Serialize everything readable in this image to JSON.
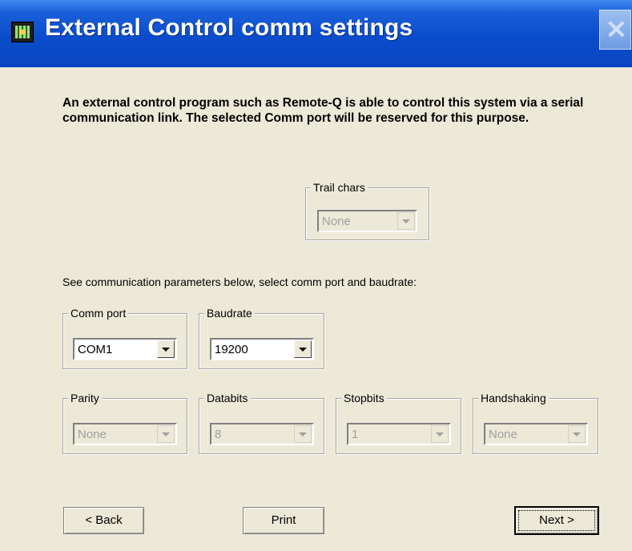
{
  "window": {
    "title": "External Control comm settings",
    "close_label": "X"
  },
  "intro": "An external control program such as Remote-Q is able to control this system via a serial communication link. The selected Comm port will be reserved for this purpose.",
  "trail_chars": {
    "label": "Trail chars",
    "value": "None",
    "enabled": false
  },
  "instruction": "See communication parameters below, select comm port and baudrate:",
  "comm_port": {
    "label": "Comm port",
    "value": "COM1",
    "enabled": true
  },
  "baudrate": {
    "label": "Baudrate",
    "value": "19200",
    "enabled": true
  },
  "parity": {
    "label": "Parity",
    "value": "None",
    "enabled": false
  },
  "databits": {
    "label": "Databits",
    "value": "8",
    "enabled": false
  },
  "stopbits": {
    "label": "Stopbits",
    "value": "1",
    "enabled": false
  },
  "handshaking": {
    "label": "Handshaking",
    "value": "None",
    "enabled": false
  },
  "buttons": {
    "back": "Back",
    "print": "Print",
    "next": "Next"
  },
  "colors": {
    "titlebar": "#0A4CCB",
    "dialog_bg": "#ECE9D8",
    "disabled_text": "#A0A0A0"
  }
}
